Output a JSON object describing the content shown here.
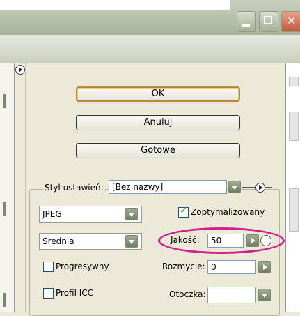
{
  "window": {
    "controls": [
      "minimize-icon",
      "maximize-icon",
      "close-icon"
    ]
  },
  "buttons": {
    "ok": "OK",
    "anuluj": "Anuluj",
    "gotowe": "Gotowe"
  },
  "settings": {
    "label": "Styl ustawień:",
    "value": "[Bez nazwy]"
  },
  "format": {
    "value": "JPEG"
  },
  "quality_preset": {
    "value": "Średnia"
  },
  "optimized": {
    "label": "Zoptymalizowany",
    "checked": true
  },
  "quality": {
    "label": "Jakość:",
    "value": "50"
  },
  "progressive": {
    "label": "Progresywny",
    "checked": false
  },
  "blur": {
    "label": "Rozmycie:",
    "value": "0"
  },
  "icc": {
    "label": "Profil ICC",
    "checked": false
  },
  "matte": {
    "label": "Otoczka:",
    "value": ""
  },
  "colors": {
    "highlight": "#d0208f",
    "ok_border": "#b5883c",
    "dropdown": "#7e8f70"
  }
}
